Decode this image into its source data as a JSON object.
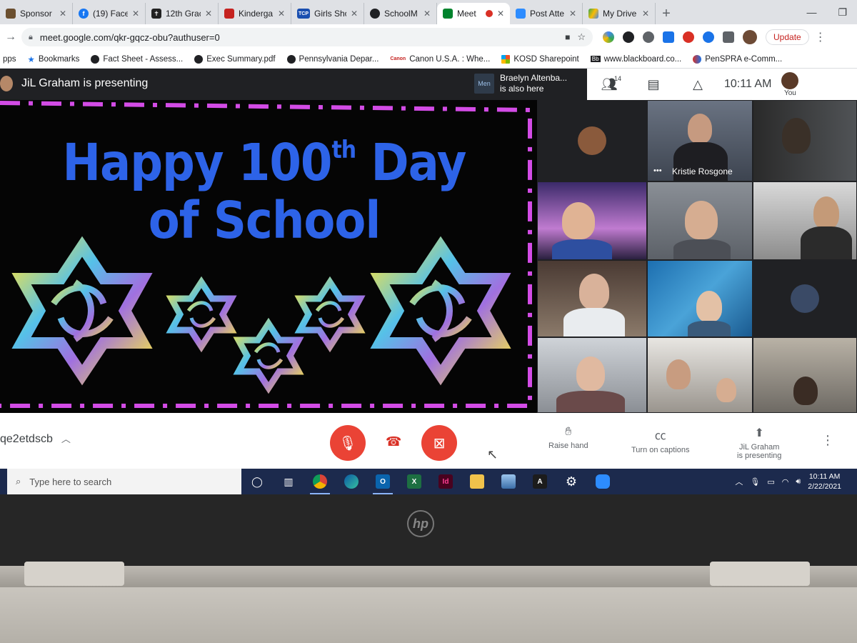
{
  "browser": {
    "tabs": [
      {
        "title": "Sponsor",
        "color": "#6b4f2f"
      },
      {
        "title": "(19) Facel",
        "color": "#1877f2"
      },
      {
        "title": "12th Grac",
        "color": "#222222"
      },
      {
        "title": "Kinderga",
        "color": "#c5221f"
      },
      {
        "title": "Girls Sho",
        "color": "#1a4fb0",
        "fav": "TCP"
      },
      {
        "title": "SchoolM",
        "color": "#202124"
      },
      {
        "title": "Meet",
        "color": "#00832d",
        "active": true
      },
      {
        "title": "Post Atte",
        "color": "#2d8cff"
      },
      {
        "title": "My Drive",
        "color": "#fbbc04"
      }
    ],
    "url": "meet.google.com/qkr-gqcz-obu?authuser=0",
    "update_label": "Update",
    "bookmarks": [
      {
        "label": "pps"
      },
      {
        "label": "Bookmarks"
      },
      {
        "label": "Fact Sheet - Assess..."
      },
      {
        "label": "Exec Summary.pdf"
      },
      {
        "label": "Pennsylvania Depar..."
      },
      {
        "label": "Canon U.S.A. : Whe..."
      },
      {
        "label": "KOSD Sharepoint"
      },
      {
        "label": "www.blackboard.co..."
      },
      {
        "label": "PenSPRA e-Comm..."
      }
    ]
  },
  "meet": {
    "presenter_text": "JiL Graham is presenting",
    "also_here_mini": "Men",
    "also_here_name": "Braelyn Altenba...",
    "also_here_sub": "is also here",
    "participant_count": "14",
    "clock": "10:11 AM",
    "you_label": "You",
    "slide": {
      "line1_a": "Happy 100",
      "line1_sup": "th",
      "line1_b": " Day",
      "line2": "of School"
    },
    "tile_name": "Kristie Rosgone",
    "meeting_code": "qe2etdscb",
    "actions": {
      "raise_hand": "Raise hand",
      "captions": "Turn on captions",
      "presenting_1": "JiL Graham",
      "presenting_2": "is presenting"
    }
  },
  "taskbar": {
    "search_placeholder": "Type here to search",
    "time": "10:11 AM",
    "date": "2/22/2021"
  },
  "laptop": {
    "brand": "hp"
  }
}
